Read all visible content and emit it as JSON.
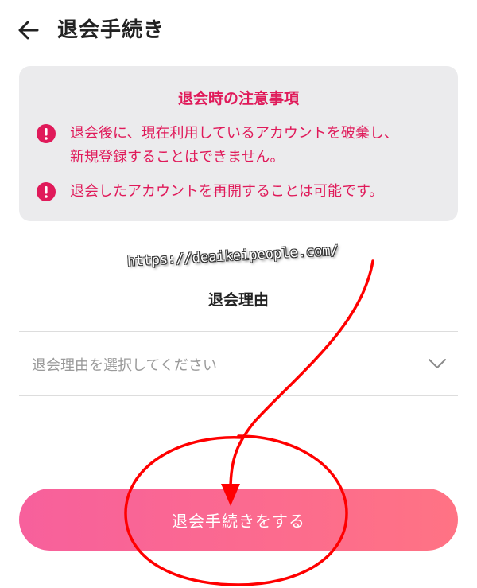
{
  "header": {
    "title": "退会手続き",
    "back_icon": "arrow-left-icon"
  },
  "notice": {
    "title": "退会時の注意事項",
    "icon": "exclamation-circle-icon",
    "items": [
      {
        "line1": "退会後に、現在利用しているアカウントを破棄し、",
        "line2": "新規登録することはできません。"
      },
      {
        "line1": "退会したアカウントを再開することは可能です。",
        "line2": ""
      }
    ]
  },
  "watermark": "https://deaikeipeople.com/",
  "reason": {
    "label": "退会理由",
    "placeholder": "退会理由を選択してください",
    "chevron_icon": "chevron-down-icon"
  },
  "submit": {
    "label": "退会手続きをする"
  },
  "colors": {
    "accent": "#e01a5a",
    "notice_bg": "#ebebed",
    "button_start": "#f7609c",
    "button_end": "#ff7384",
    "annotation": "#ff0000"
  }
}
